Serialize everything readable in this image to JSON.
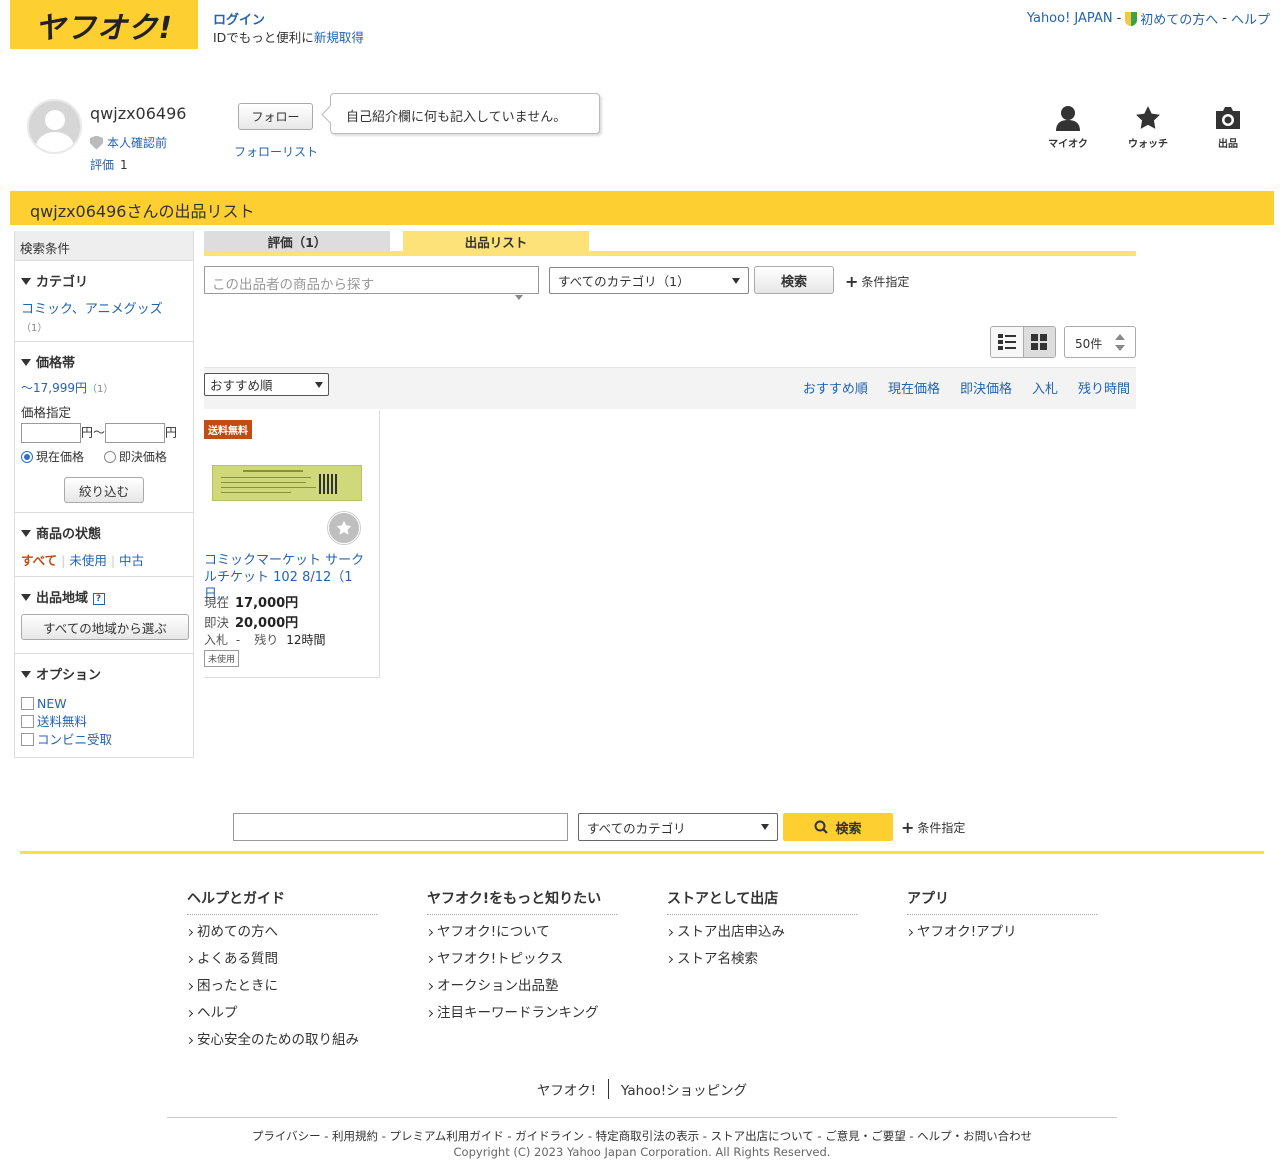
{
  "header": {
    "logo": "ヤフオク!",
    "login": "ログイン",
    "login_sub_pre": "IDでもっと便利に",
    "login_sub_link": "新規取得",
    "yahoo_japan": "Yahoo! JAPAN",
    "first_time": "初めての方へ",
    "help": "ヘルプ",
    "sep": "-"
  },
  "profile": {
    "username": "qwjzx06496",
    "verify": "本人確認前",
    "rating_label": "評価",
    "rating_value": "1",
    "follow": "フォロー",
    "follow_list": "フォローリスト",
    "bio": "自己紹介欄に何も記入していません。",
    "icons": {
      "myauc": "マイオク",
      "watch": "ウォッチ",
      "sell": "出品"
    }
  },
  "page_bar": "qwjzx06496さんの出品リスト",
  "sidebar": {
    "header": "検索条件",
    "category": {
      "title": "カテゴリ",
      "item": "コミック、アニメグッズ",
      "count": "（1）"
    },
    "price": {
      "title": "価格帯",
      "range": "〜17,999円",
      "range_count": "（1）",
      "spec": "価格指定",
      "yen1": "円〜",
      "yen2": "円",
      "radio_current": "現在価格",
      "radio_buyout": "即決価格",
      "filter_btn": "絞り込む"
    },
    "condition": {
      "title": "商品の状態",
      "all": "すべて",
      "unused": "未使用",
      "used": "中古"
    },
    "region": {
      "title": "出品地域",
      "help": "?",
      "btn": "すべての地域から選ぶ"
    },
    "options": {
      "title": "オプション",
      "items": [
        "NEW",
        "送料無料",
        "コンビニ受取"
      ]
    }
  },
  "tabs": {
    "rating": "評価（1）",
    "listing": "出品リスト"
  },
  "search": {
    "placeholder": "この出品者の商品から探す",
    "category": "すべてのカテゴリ（1）",
    "button": "検索",
    "advanced": "条件指定"
  },
  "view": {
    "per_page": "50件"
  },
  "sort": {
    "select": "おすすめ順",
    "links": [
      "おすすめ順",
      "現在価格",
      "即決価格",
      "入札",
      "残り時間"
    ]
  },
  "item": {
    "badge": "送料無料",
    "title": "コミックマーケット サークルチケット 102 8/12（1日...",
    "current_label": "現在",
    "current_price": "17,000円",
    "buyout_label": "即決",
    "buyout_price": "20,000円",
    "bid_label": "入札",
    "bid_value": "-",
    "remain_label": "残り",
    "remain_value": "12時間",
    "condition": "未使用"
  },
  "bottom_search": {
    "category": "すべてのカテゴリ",
    "button": "検索",
    "advanced": "条件指定"
  },
  "footer": {
    "cols": [
      {
        "title": "ヘルプとガイド",
        "items": [
          "初めての方へ",
          "よくある質問",
          "困ったときに",
          "ヘルプ",
          "安心安全のための取り組み"
        ]
      },
      {
        "title": "ヤフオク!をもっと知りたい",
        "items": [
          "ヤフオク!について",
          "ヤフオク!トピックス",
          "オークション出品塾",
          "注目キーワードランキング"
        ]
      },
      {
        "title": "ストアとして出店",
        "items": [
          "ストア出店申込み",
          "ストア名検索"
        ]
      },
      {
        "title": "アプリ",
        "items": [
          "ヤフオク!アプリ"
        ]
      }
    ],
    "brands": [
      "ヤフオク!",
      "Yahoo!ショッピング"
    ],
    "legal": "プライバシー - 利用規約 - プレミアム利用ガイド - ガイドライン - 特定商取引法の表示 - ストア出店について - ご意見・ご要望 - ヘルプ・お問い合わせ",
    "copyright": "Copyright (C) 2023 Yahoo Japan Corporation. All Rights Reserved."
  },
  "colors": {
    "brand_yellow": "#fecf31",
    "link": "#2463b0",
    "badge": "#c24d13"
  }
}
